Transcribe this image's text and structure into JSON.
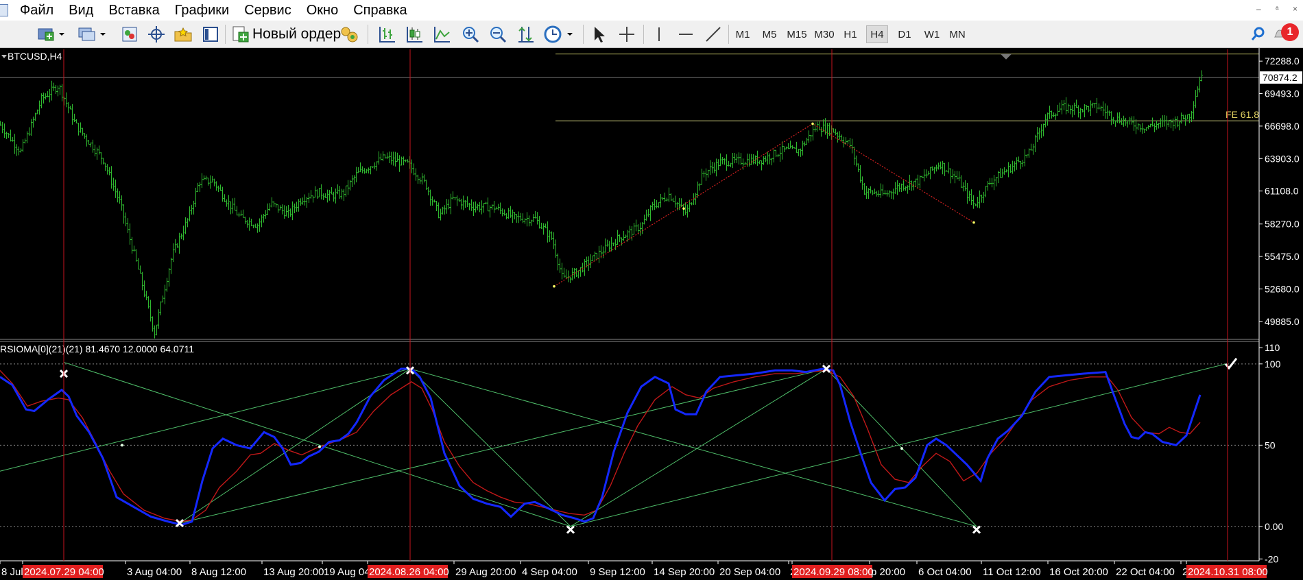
{
  "menu": [
    "Файл",
    "Вид",
    "Вставка",
    "Графики",
    "Сервис",
    "Окно",
    "Справка"
  ],
  "window_controls": [
    "‒",
    "ᵃ",
    "×"
  ],
  "toolbar": {
    "new_order_label": "Новый ордер",
    "timeframes": [
      "M1",
      "M5",
      "M15",
      "M30",
      "H1",
      "H4",
      "D1",
      "W1",
      "MN"
    ],
    "active_timeframe": "H4",
    "notification_count": "1"
  },
  "icons": [
    "new-chart-icon",
    "profiles-icon",
    "market-watch-icon",
    "navigator-icon",
    "favorites-icon",
    "data-window-icon",
    "new-order-icon",
    "autotrading-icon",
    "bar-chart-icon",
    "candlestick-icon",
    "line-chart-icon",
    "zoom-in-icon",
    "zoom-out-icon",
    "indicators-icon",
    "periods-clock-icon",
    "cursor-icon",
    "crosshair-icon",
    "vertical-line-icon",
    "horizontal-line-icon",
    "trendline-icon",
    "search-icon",
    "notification-icon"
  ],
  "chart_data": [
    {
      "type": "candlestick",
      "symbol_title": "BTCUSD,H4",
      "ylim": [
        48400,
        73300
      ],
      "yticks": [
        "72288.0",
        "69493.0",
        "66698.0",
        "63903.0",
        "61108.0",
        "58270.0",
        "55475.0",
        "52680.0",
        "49885.0"
      ],
      "current_price_label": "70874.2",
      "current_price": 70874.2,
      "fibo_label": "FE 61.8",
      "fibo_level": 67150,
      "top_level": 72900,
      "price_path": [
        [
          0,
          66800
        ],
        [
          30,
          64500
        ],
        [
          60,
          69000
        ],
        [
          85,
          70200
        ],
        [
          110,
          66800
        ],
        [
          150,
          63800
        ],
        [
          175,
          60000
        ],
        [
          205,
          53500
        ],
        [
          225,
          48900
        ],
        [
          250,
          55500
        ],
        [
          275,
          58900
        ],
        [
          290,
          61900
        ],
        [
          310,
          62000
        ],
        [
          330,
          60300
        ],
        [
          350,
          58800
        ],
        [
          375,
          58200
        ],
        [
          395,
          60000
        ],
        [
          420,
          59100
        ],
        [
          440,
          60500
        ],
        [
          465,
          61000
        ],
        [
          480,
          60700
        ],
        [
          500,
          60900
        ],
        [
          520,
          62600
        ],
        [
          560,
          64000
        ],
        [
          595,
          63400
        ],
        [
          620,
          61700
        ],
        [
          640,
          59000
        ],
        [
          660,
          60400
        ],
        [
          690,
          59800
        ],
        [
          720,
          59700
        ],
        [
          750,
          58800
        ],
        [
          780,
          58700
        ],
        [
          805,
          57000
        ],
        [
          820,
          53500
        ],
        [
          840,
          54100
        ],
        [
          870,
          55600
        ],
        [
          900,
          57000
        ],
        [
          935,
          58100
        ],
        [
          950,
          59700
        ],
        [
          975,
          60800
        ],
        [
          1000,
          59200
        ],
        [
          1025,
          62600
        ],
        [
          1050,
          63600
        ],
        [
          1080,
          63700
        ],
        [
          1110,
          63800
        ],
        [
          1140,
          64600
        ],
        [
          1165,
          64600
        ],
        [
          1190,
          66700
        ],
        [
          1215,
          66300
        ],
        [
          1240,
          65000
        ],
        [
          1260,
          61100
        ],
        [
          1290,
          60800
        ],
        [
          1310,
          61500
        ],
        [
          1340,
          62000
        ],
        [
          1370,
          63500
        ],
        [
          1395,
          62200
        ],
        [
          1420,
          59900
        ],
        [
          1445,
          62000
        ],
        [
          1470,
          63000
        ],
        [
          1500,
          64300
        ],
        [
          1525,
          67500
        ],
        [
          1550,
          68300
        ],
        [
          1575,
          68200
        ],
        [
          1600,
          68400
        ],
        [
          1625,
          67400
        ],
        [
          1650,
          66900
        ],
        [
          1670,
          66600
        ],
        [
          1690,
          66900
        ],
        [
          1715,
          67100
        ],
        [
          1735,
          67700
        ],
        [
          1752,
          71300
        ]
      ],
      "zigzag": [
        [
          808,
          52900
        ],
        [
          1185,
          66900
        ],
        [
          1420,
          58400
        ]
      ],
      "zigzag_mid": [
        [
          997,
          59600
        ]
      ]
    },
    {
      "type": "line",
      "indicator_title": "RSIOMA[0](21)(21) 81.4670 12.0000 64.0711",
      "ylim": [
        -22,
        113
      ],
      "yticks": [
        "110",
        "100",
        "50",
        "0.00",
        "-20"
      ],
      "levels": [
        100,
        50,
        0
      ],
      "rsi_blue": [
        [
          0,
          92
        ],
        [
          18,
          87
        ],
        [
          38,
          72
        ],
        [
          50,
          71
        ],
        [
          70,
          78
        ],
        [
          90,
          84
        ],
        [
          100,
          80
        ],
        [
          112,
          68
        ],
        [
          130,
          58
        ],
        [
          150,
          42
        ],
        [
          170,
          18
        ],
        [
          195,
          12
        ],
        [
          220,
          6
        ],
        [
          245,
          3
        ],
        [
          265,
          1
        ],
        [
          280,
          3
        ],
        [
          295,
          28
        ],
        [
          310,
          48
        ],
        [
          325,
          54
        ],
        [
          345,
          50
        ],
        [
          365,
          48
        ],
        [
          385,
          58
        ],
        [
          400,
          55
        ],
        [
          412,
          48
        ],
        [
          424,
          38
        ],
        [
          438,
          39
        ],
        [
          450,
          43
        ],
        [
          465,
          46
        ],
        [
          480,
          52
        ],
        [
          495,
          53
        ],
        [
          508,
          57
        ],
        [
          520,
          64
        ],
        [
          540,
          80
        ],
        [
          560,
          90
        ],
        [
          585,
          97
        ],
        [
          600,
          97
        ],
        [
          612,
          92
        ],
        [
          628,
          79
        ],
        [
          648,
          45
        ],
        [
          670,
          25
        ],
        [
          690,
          17
        ],
        [
          710,
          14
        ],
        [
          730,
          12
        ],
        [
          745,
          6
        ],
        [
          765,
          14
        ],
        [
          780,
          15
        ],
        [
          800,
          11
        ],
        [
          820,
          7
        ],
        [
          838,
          5
        ],
        [
          852,
          3
        ],
        [
          865,
          5
        ],
        [
          878,
          18
        ],
        [
          895,
          46
        ],
        [
          915,
          70
        ],
        [
          935,
          86
        ],
        [
          955,
          92
        ],
        [
          975,
          88
        ],
        [
          985,
          72
        ],
        [
          1000,
          69
        ],
        [
          1015,
          69
        ],
        [
          1030,
          83
        ],
        [
          1050,
          92
        ],
        [
          1075,
          93
        ],
        [
          1100,
          94
        ],
        [
          1130,
          96
        ],
        [
          1155,
          96
        ],
        [
          1175,
          95
        ],
        [
          1200,
          97
        ],
        [
          1215,
          96
        ],
        [
          1225,
          87
        ],
        [
          1240,
          64
        ],
        [
          1255,
          45
        ],
        [
          1270,
          27
        ],
        [
          1290,
          16
        ],
        [
          1305,
          23
        ],
        [
          1320,
          24
        ],
        [
          1335,
          30
        ],
        [
          1352,
          50
        ],
        [
          1365,
          54
        ],
        [
          1380,
          50
        ],
        [
          1395,
          44
        ],
        [
          1410,
          38
        ],
        [
          1430,
          28
        ],
        [
          1440,
          42
        ],
        [
          1455,
          54
        ],
        [
          1470,
          59
        ],
        [
          1490,
          68
        ],
        [
          1510,
          83
        ],
        [
          1530,
          92
        ],
        [
          1555,
          93
        ],
        [
          1580,
          94
        ],
        [
          1612,
          95
        ],
        [
          1625,
          80
        ],
        [
          1640,
          63
        ],
        [
          1650,
          55
        ],
        [
          1660,
          54
        ],
        [
          1670,
          58
        ],
        [
          1680,
          57
        ],
        [
          1695,
          52
        ],
        [
          1715,
          50
        ],
        [
          1730,
          56
        ],
        [
          1750,
          81
        ]
      ],
      "rsi_red": [
        [
          0,
          96
        ],
        [
          18,
          88
        ],
        [
          40,
          74
        ],
        [
          60,
          77
        ],
        [
          85,
          79
        ],
        [
          100,
          78
        ],
        [
          120,
          67
        ],
        [
          140,
          51
        ],
        [
          160,
          34
        ],
        [
          180,
          20
        ],
        [
          210,
          10
        ],
        [
          240,
          5
        ],
        [
          265,
          3
        ],
        [
          280,
          4
        ],
        [
          300,
          10
        ],
        [
          320,
          24
        ],
        [
          345,
          34
        ],
        [
          365,
          44
        ],
        [
          380,
          45
        ],
        [
          400,
          51
        ],
        [
          420,
          47
        ],
        [
          440,
          44
        ],
        [
          460,
          48
        ],
        [
          480,
          51
        ],
        [
          500,
          54
        ],
        [
          520,
          58
        ],
        [
          545,
          71
        ],
        [
          570,
          81
        ],
        [
          600,
          89
        ],
        [
          615,
          85
        ],
        [
          630,
          72
        ],
        [
          648,
          52
        ],
        [
          670,
          37
        ],
        [
          690,
          27
        ],
        [
          710,
          22
        ],
        [
          730,
          18
        ],
        [
          750,
          15
        ],
        [
          770,
          14
        ],
        [
          790,
          12
        ],
        [
          810,
          10
        ],
        [
          830,
          8
        ],
        [
          852,
          7
        ],
        [
          870,
          10
        ],
        [
          890,
          25
        ],
        [
          910,
          45
        ],
        [
          930,
          62
        ],
        [
          955,
          78
        ],
        [
          980,
          86
        ],
        [
          1000,
          81
        ],
        [
          1020,
          79
        ],
        [
          1040,
          85
        ],
        [
          1070,
          89
        ],
        [
          1100,
          92
        ],
        [
          1130,
          94
        ],
        [
          1160,
          94
        ],
        [
          1180,
          95
        ],
        [
          1205,
          96
        ],
        [
          1225,
          92
        ],
        [
          1245,
          80
        ],
        [
          1265,
          60
        ],
        [
          1285,
          38
        ],
        [
          1305,
          29
        ],
        [
          1325,
          27
        ],
        [
          1345,
          37
        ],
        [
          1365,
          45
        ],
        [
          1385,
          40
        ],
        [
          1405,
          28
        ],
        [
          1425,
          33
        ],
        [
          1445,
          45
        ],
        [
          1465,
          54
        ],
        [
          1485,
          66
        ],
        [
          1505,
          78
        ],
        [
          1530,
          86
        ],
        [
          1560,
          90
        ],
        [
          1590,
          92
        ],
        [
          1615,
          92
        ],
        [
          1630,
          84
        ],
        [
          1650,
          67
        ],
        [
          1670,
          58
        ],
        [
          1690,
          57
        ],
        [
          1705,
          61
        ],
        [
          1720,
          58
        ],
        [
          1735,
          57
        ],
        [
          1750,
          64
        ]
      ],
      "zigzag_points": [
        [
          93,
          101
        ],
        [
          262,
          2
        ],
        [
          598,
          97
        ],
        [
          832,
          0
        ],
        [
          1205,
          97
        ],
        [
          1424,
          0
        ]
      ],
      "zigzag_mids": [
        [
          178,
          50
        ],
        [
          466,
          49
        ],
        [
          1315,
          48
        ]
      ],
      "green_lines": [
        [
          [
            0,
            34
          ],
          [
            598,
            97
          ]
        ],
        [
          [
            93,
            101
          ],
          [
            832,
            0
          ]
        ],
        [
          [
            262,
            2
          ],
          [
            598,
            97
          ]
        ],
        [
          [
            262,
            2
          ],
          [
            1205,
            97
          ]
        ],
        [
          [
            598,
            97
          ],
          [
            832,
            0
          ]
        ],
        [
          [
            598,
            97
          ],
          [
            1424,
            0
          ]
        ],
        [
          [
            832,
            0
          ],
          [
            1205,
            97
          ]
        ],
        [
          [
            832,
            0
          ],
          [
            1788,
            100
          ]
        ],
        [
          [
            1205,
            97
          ],
          [
            1424,
            0
          ]
        ]
      ],
      "cross_markers": [
        [
          93,
          94
        ],
        [
          262,
          2
        ],
        [
          598,
          96
        ],
        [
          832,
          -2
        ],
        [
          1205,
          97
        ],
        [
          1424,
          -2
        ]
      ],
      "check_marker": [
        1795,
        100
      ]
    },
    {
      "type": "time_axis",
      "labels": [
        "8 Jul",
        "2024.07.29 04:00",
        "3 Aug 04:00",
        "8 Aug 12:00",
        "13 Aug 20:00",
        "19 Aug 04:",
        "2024.08.26 04:00",
        "29 Aug 20:00",
        "4 Sep 04:00",
        "9 Sep 12:00",
        "14 Sep 20:00",
        "20 Sep 04:00",
        "2",
        "2024.09.29 08:00",
        "p 20:00",
        "6 Oct 04:00",
        "11 Oct 12:00",
        "16 Oct 20:00",
        "22 Oct 04:00",
        "2",
        "2024.10.31 08:00"
      ],
      "markers": [
        "2024.07.29 04:00",
        "2024.08.26 04:00",
        "2024.09.29 08:00",
        "2024.10.31 08:00"
      ]
    }
  ]
}
